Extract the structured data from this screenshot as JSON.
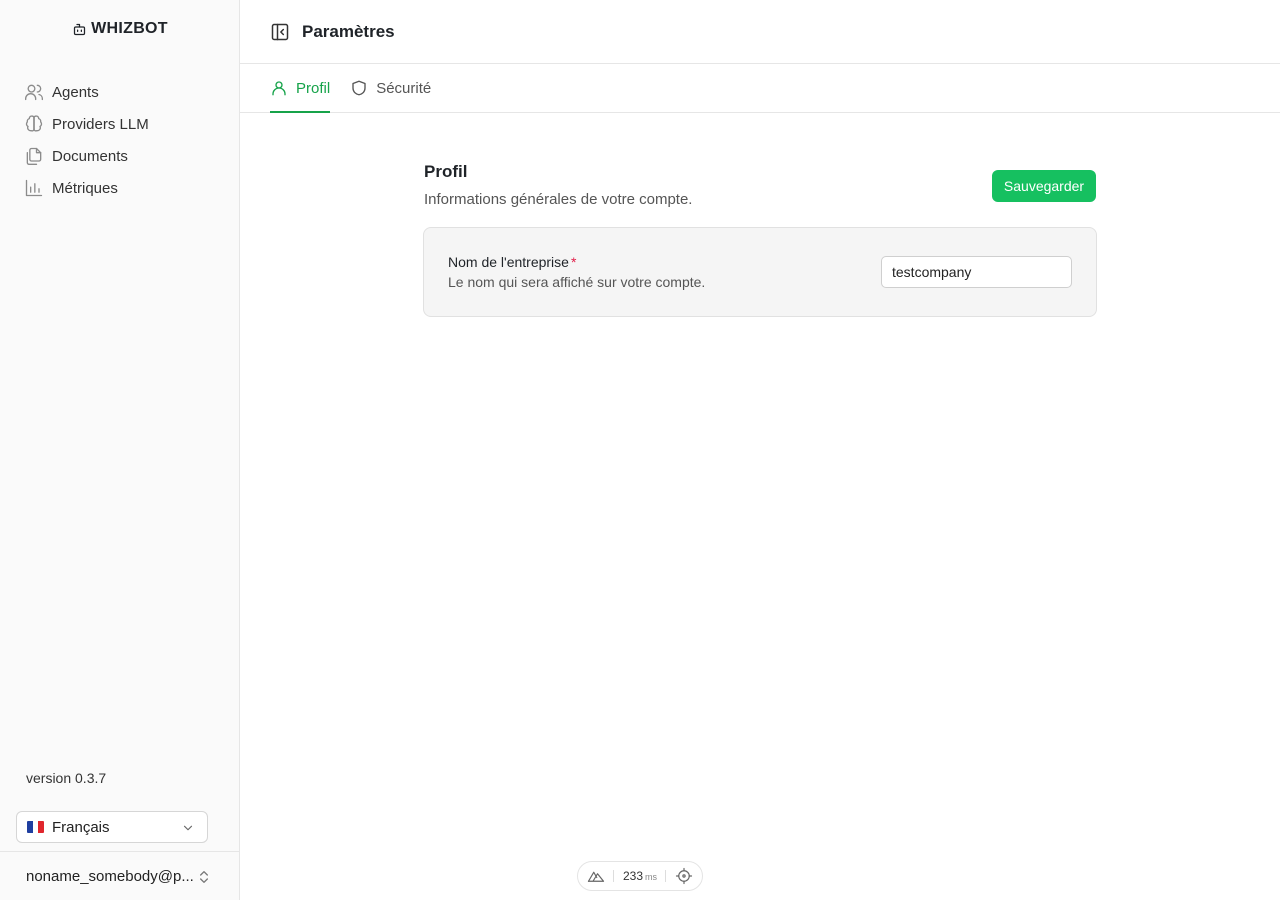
{
  "brand": {
    "name": "WHIZBOT"
  },
  "sidebar": {
    "items": [
      {
        "label": "Agents",
        "icon": "users-icon"
      },
      {
        "label": "Providers LLM",
        "icon": "brain-icon"
      },
      {
        "label": "Documents",
        "icon": "files-icon"
      },
      {
        "label": "Métriques",
        "icon": "bar-chart-icon"
      }
    ],
    "version": "version 0.3.7",
    "language": {
      "selected": "Français",
      "flag": "fr"
    },
    "user": {
      "email": "noname_somebody@p..."
    }
  },
  "header": {
    "title": "Paramètres"
  },
  "tabs": [
    {
      "label": "Profil",
      "active": true
    },
    {
      "label": "Sécurité",
      "active": false
    }
  ],
  "profile": {
    "title": "Profil",
    "subtitle": "Informations générales de votre compte.",
    "save_label": "Sauvegarder",
    "fields": [
      {
        "label": "Nom de l'entreprise",
        "required_mark": "*",
        "help": "Le nom qui sera affiché sur votre compte.",
        "value": "testcompany"
      }
    ]
  },
  "devbar": {
    "latency": "233",
    "unit": "ms"
  },
  "colors": {
    "accent": "#16a34a",
    "button": "#16c060",
    "required": "#e11d48"
  }
}
